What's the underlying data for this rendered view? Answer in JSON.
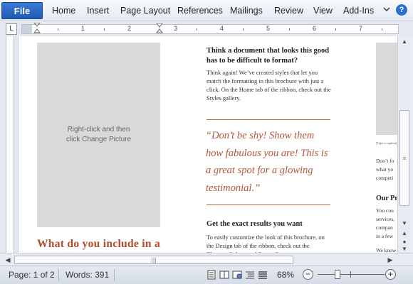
{
  "ribbon": {
    "file_label": "File",
    "tabs": [
      "Home",
      "Insert",
      "Page Layout",
      "References",
      "Mailings",
      "Review",
      "View",
      "Add-Ins"
    ],
    "help_label": "?"
  },
  "ruler": {
    "tab_selector": "L",
    "numbers": [
      "1",
      "2",
      "3",
      "4",
      "5",
      "6",
      "7"
    ]
  },
  "document": {
    "picture_placeholder_text": "Right-click and then click Change Picture",
    "left_heading": "What do you include in a",
    "middle": {
      "heading1": "Think a document that looks this good has to be difficult to format?",
      "body1": "Think again! We’ve created styles that let you match the formatting in this brochure with just a click. On the Home tab of the ribbon, check out the Styles gallery.",
      "quote": "“Don’t be shy! Show them how fabulous  you are! This is a great spot for a glowing testimonial.”",
      "heading2": "Get the exact results you want",
      "body2": "To easily  customize the look of this brochure, on the Design  tab of the ribbon, check out the Themes, Colors, and Fonts. Go"
    },
    "right": {
      "caption": "[Type a caption]",
      "lines": [
        "Don’t fo",
        "what yo",
        "competi"
      ],
      "heading": "Our Pr",
      "lines2": [
        "You cou",
        "services,",
        "compan",
        "in a few"
      ],
      "line3": "We know"
    }
  },
  "statusbar": {
    "page": "Page: 1 of 2",
    "words": "Words: 391",
    "zoom": "68%",
    "zoom_fraction": 0.3
  },
  "colors": {
    "accent": "#b3563a",
    "file_tab": "#2b6fd0"
  }
}
